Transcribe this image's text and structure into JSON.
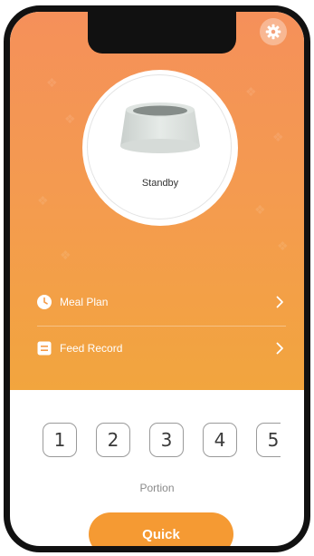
{
  "device": {
    "status": "Standby"
  },
  "menu": {
    "meal_plan_label": "Meal Plan",
    "feed_record_label": "Feed Record"
  },
  "portions": [
    "1",
    "2",
    "3",
    "4",
    "5"
  ],
  "portion_label": "Portion",
  "quick_label": "Quick",
  "colors": {
    "accent": "#F59A33",
    "hero_top": "#F5905A",
    "hero_bottom": "#F2A53E"
  },
  "icons": [
    "gear-icon",
    "clock-icon",
    "list-icon",
    "chevron-right-icon",
    "bowl-image"
  ]
}
